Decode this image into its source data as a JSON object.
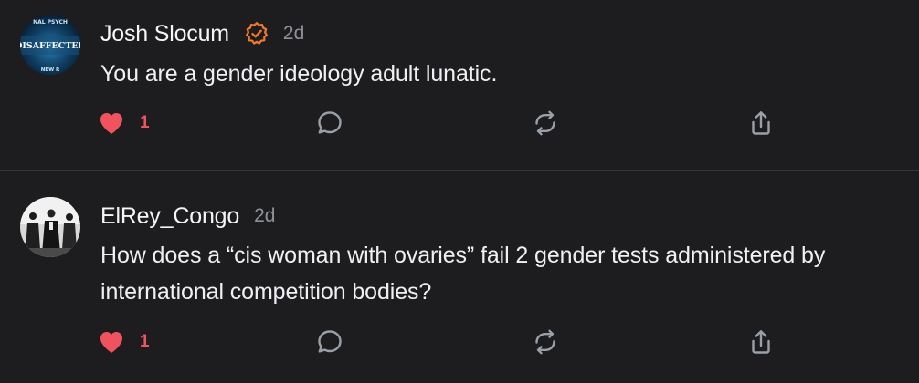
{
  "posts": [
    {
      "author": "Josh Slocum",
      "verified_badge": "verified-check-icon",
      "time": "2d",
      "text": "You are a gender ideology adult lunatic.",
      "avatar": {
        "top_text": "NAL PSYCH",
        "main_text": "DISAFFECTED",
        "bottom_text": "NEW R"
      },
      "likes": "1",
      "liked": true,
      "icons": {
        "like": "heart-icon",
        "reply": "comment-bubble-icon",
        "repost": "repost-icon",
        "share": "share-icon"
      }
    },
    {
      "author": "ElRey_Congo",
      "time": "2d",
      "text": "How does a “cis woman with ovaries” fail 2 gender tests administered by international competition bodies?",
      "likes": "1",
      "liked": true,
      "icons": {
        "like": "heart-icon",
        "reply": "comment-bubble-icon",
        "repost": "repost-icon",
        "share": "share-icon"
      }
    }
  ],
  "colors": {
    "background": "#1d1d1f",
    "like_red": "#f0535d",
    "badge_orange": "#f07a2a",
    "muted": "#8e9198",
    "divider": "#34363b"
  }
}
